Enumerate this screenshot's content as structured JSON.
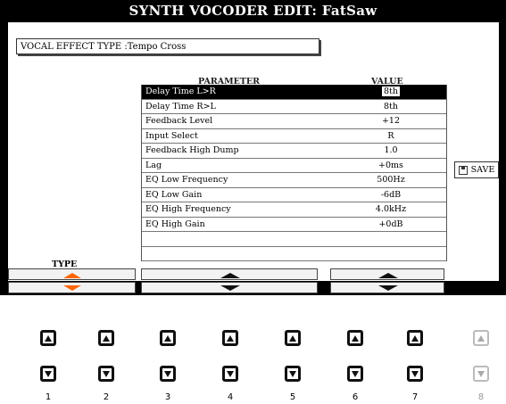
{
  "title": "SYNTH VOCODER EDIT: FatSaw",
  "vocal_effect_type": {
    "label": "VOCAL EFFECT TYPE :",
    "value": "Tempo Cross"
  },
  "table": {
    "col_parameter": "PARAMETER",
    "col_value": "VALUE",
    "rows": [
      {
        "param": "Delay Time L>R",
        "value": "8th",
        "selected": true
      },
      {
        "param": "Delay Time R>L",
        "value": "8th"
      },
      {
        "param": "Feedback Level",
        "value": "+12"
      },
      {
        "param": "Input Select",
        "value": "R"
      },
      {
        "param": "Feedback High Dump",
        "value": "1.0"
      },
      {
        "param": "Lag",
        "value": "+0ms"
      },
      {
        "param": "EQ Low Frequency",
        "value": "500Hz"
      },
      {
        "param": "EQ Low Gain",
        "value": "-6dB"
      },
      {
        "param": "EQ High Frequency",
        "value": "4.0kHz"
      },
      {
        "param": "EQ High Gain",
        "value": "+0dB"
      }
    ]
  },
  "save_label": "SAVE",
  "type_label": "TYPE",
  "accent_color": "#ff6600",
  "hardware_buttons": [
    "1",
    "2",
    "3",
    "4",
    "5",
    "6",
    "7",
    "8"
  ]
}
